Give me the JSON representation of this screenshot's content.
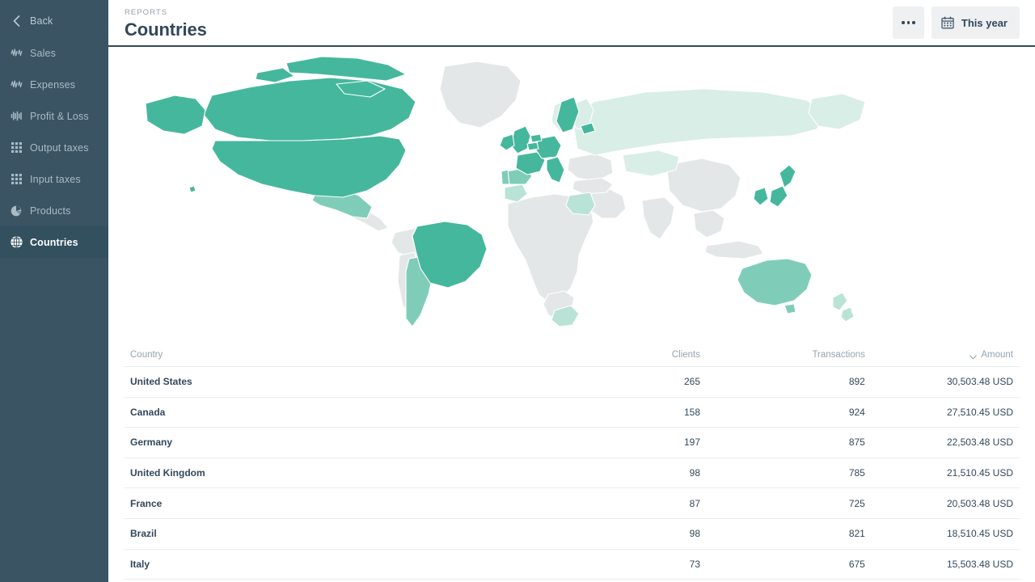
{
  "sidebar": {
    "items": [
      {
        "label": "Back",
        "icon": "chevron-left-icon",
        "key": "back",
        "active": false
      },
      {
        "label": "Sales",
        "icon": "wave-icon",
        "key": "sales",
        "active": false
      },
      {
        "label": "Expenses",
        "icon": "wave-icon",
        "key": "expenses",
        "active": false
      },
      {
        "label": "Profit & Loss",
        "icon": "bars-icon",
        "key": "profit-loss",
        "active": false
      },
      {
        "label": "Output taxes",
        "icon": "grid-icon",
        "key": "output-taxes",
        "active": false
      },
      {
        "label": "Input taxes",
        "icon": "grid-icon",
        "key": "input-taxes",
        "active": false
      },
      {
        "label": "Products",
        "icon": "pie-chart-icon",
        "key": "products",
        "active": false
      },
      {
        "label": "Countries",
        "icon": "globe-icon",
        "key": "countries",
        "active": true
      }
    ]
  },
  "header": {
    "eyebrow": "REPORTS",
    "title": "Countries",
    "more_label": "",
    "period_label": "This year"
  },
  "table": {
    "columns": [
      "Country",
      "Clients",
      "Transactions",
      "Amount"
    ],
    "sort": {
      "column": "Amount",
      "direction": "desc"
    },
    "rows": [
      {
        "country": "United States",
        "clients": "265",
        "transactions": "892",
        "amount": "30,503.48 USD"
      },
      {
        "country": "Canada",
        "clients": "158",
        "transactions": "924",
        "amount": "27,510.45 USD"
      },
      {
        "country": "Germany",
        "clients": "197",
        "transactions": "875",
        "amount": "22,503.48 USD"
      },
      {
        "country": "United Kingdom",
        "clients": "98",
        "transactions": "785",
        "amount": "21,510.45 USD"
      },
      {
        "country": "France",
        "clients": "87",
        "transactions": "725",
        "amount": "20,503.48 USD"
      },
      {
        "country": "Brazil",
        "clients": "98",
        "transactions": "821",
        "amount": "18,510.45 USD"
      },
      {
        "country": "Italy",
        "clients": "73",
        "transactions": "675",
        "amount": "15,503.48 USD"
      }
    ]
  },
  "chart_data": {
    "type": "heatmap",
    "title": "Countries",
    "subtype": "choropleth-world-map",
    "legend_position": "none",
    "colors": {
      "high": "#45b79d",
      "medium": "#7fcdb8",
      "low": "#b9e3d6",
      "minimal": "#d9eee6",
      "none": "#e4e7e8",
      "background": "#ffffff",
      "border": "#ffffff"
    },
    "value_key": "amount_usd",
    "regions": [
      {
        "name": "United States",
        "level": "high",
        "amount_usd": 30503.48,
        "clients": 265,
        "transactions": 892
      },
      {
        "name": "Canada",
        "level": "high",
        "amount_usd": 27510.45,
        "clients": 158,
        "transactions": 924
      },
      {
        "name": "Germany",
        "level": "high",
        "amount_usd": 22503.48,
        "clients": 197,
        "transactions": 875
      },
      {
        "name": "United Kingdom",
        "level": "high",
        "amount_usd": 21510.45,
        "clients": 98,
        "transactions": 785
      },
      {
        "name": "France",
        "level": "high",
        "amount_usd": 20503.48,
        "clients": 87,
        "transactions": 725
      },
      {
        "name": "Brazil",
        "level": "high",
        "amount_usd": 18510.45,
        "clients": 98,
        "transactions": 821
      },
      {
        "name": "Italy",
        "level": "high",
        "amount_usd": 15503.48,
        "clients": 73,
        "transactions": 675
      },
      {
        "name": "Sweden",
        "level": "high"
      },
      {
        "name": "Ireland",
        "level": "high"
      },
      {
        "name": "Netherlands",
        "level": "high"
      },
      {
        "name": "Belgium",
        "level": "high"
      },
      {
        "name": "Japan",
        "level": "high"
      },
      {
        "name": "South Korea",
        "level": "high"
      },
      {
        "name": "Estonia",
        "level": "high"
      },
      {
        "name": "Spain",
        "level": "medium"
      },
      {
        "name": "Portugal",
        "level": "medium"
      },
      {
        "name": "Mexico",
        "level": "medium"
      },
      {
        "name": "Argentina",
        "level": "medium"
      },
      {
        "name": "Australia",
        "level": "medium"
      },
      {
        "name": "Egypt",
        "level": "low"
      },
      {
        "name": "Morocco",
        "level": "low"
      },
      {
        "name": "South Africa",
        "level": "low"
      },
      {
        "name": "New Zealand",
        "level": "low"
      },
      {
        "name": "Russia",
        "level": "minimal"
      },
      {
        "name": "Kazakhstan",
        "level": "minimal"
      },
      {
        "name": "Norway",
        "level": "minimal"
      },
      {
        "name": "Finland",
        "level": "minimal"
      },
      {
        "name": "Greenland",
        "level": "none"
      },
      {
        "name": "China",
        "level": "none"
      },
      {
        "name": "India",
        "level": "none"
      }
    ]
  }
}
